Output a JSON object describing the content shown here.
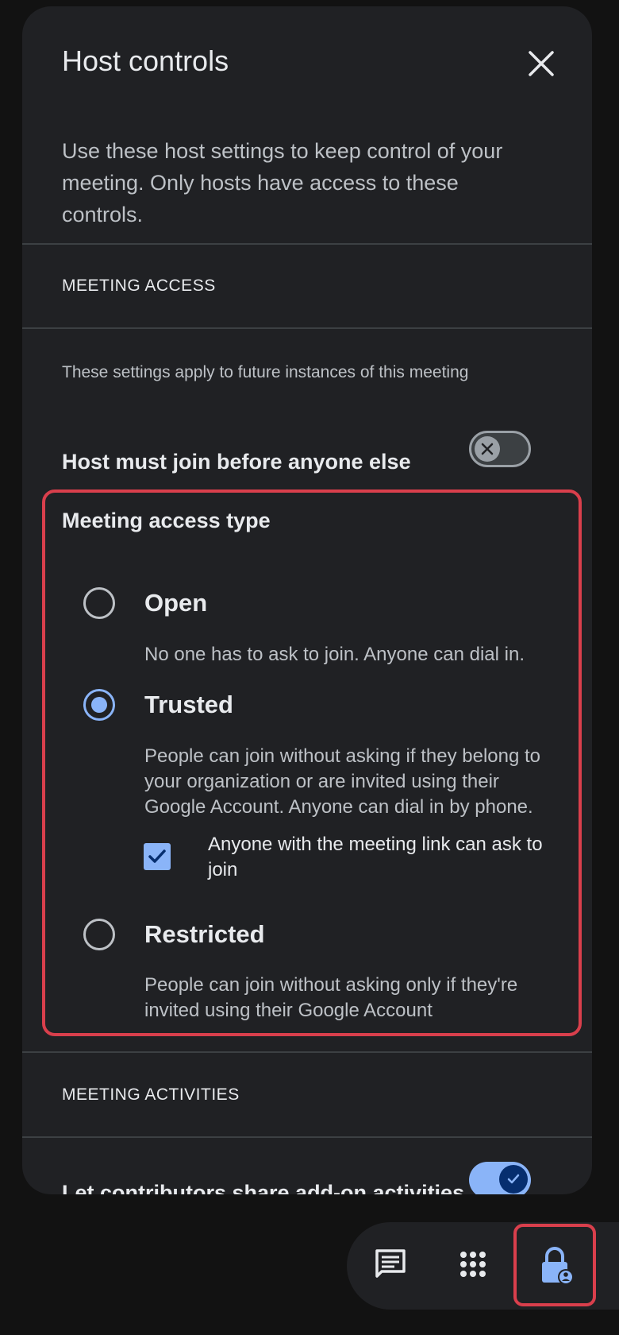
{
  "panel": {
    "title": "Host controls",
    "close_icon": "close-icon",
    "intro": "Use these host settings to keep control of your meeting. Only hosts have access to these controls."
  },
  "meeting_access": {
    "header": "MEETING ACCESS",
    "note": "These settings apply to future instances of this meeting",
    "host_first": {
      "label": "Host must join before anyone else",
      "enabled": false
    },
    "access_type": {
      "title": "Meeting access type",
      "selected": "Trusted",
      "options": [
        {
          "label": "Open",
          "description": "No one has to ask to join. Anyone can dial in."
        },
        {
          "label": "Trusted",
          "description": "People can join without asking if they belong to your organization or are invited using their Google Account. Anyone can dial in by phone."
        },
        {
          "label": "Restricted",
          "description": "People can join without asking only if they're invited using their Google Account"
        }
      ],
      "ask_to_join": {
        "label": "Anyone with the meeting link can ask to join",
        "checked": true
      }
    }
  },
  "meeting_activities": {
    "header": "MEETING ACTIVITIES",
    "addon": {
      "label": "Let contributors share add-on activities",
      "enabled": true
    }
  },
  "toolbar": {
    "icons": [
      "chat-icon",
      "apps-grid-icon",
      "host-lock-icon"
    ]
  },
  "colors": {
    "accent": "#8ab4f8",
    "highlight": "#d93f4c",
    "panel_bg": "#202124"
  }
}
